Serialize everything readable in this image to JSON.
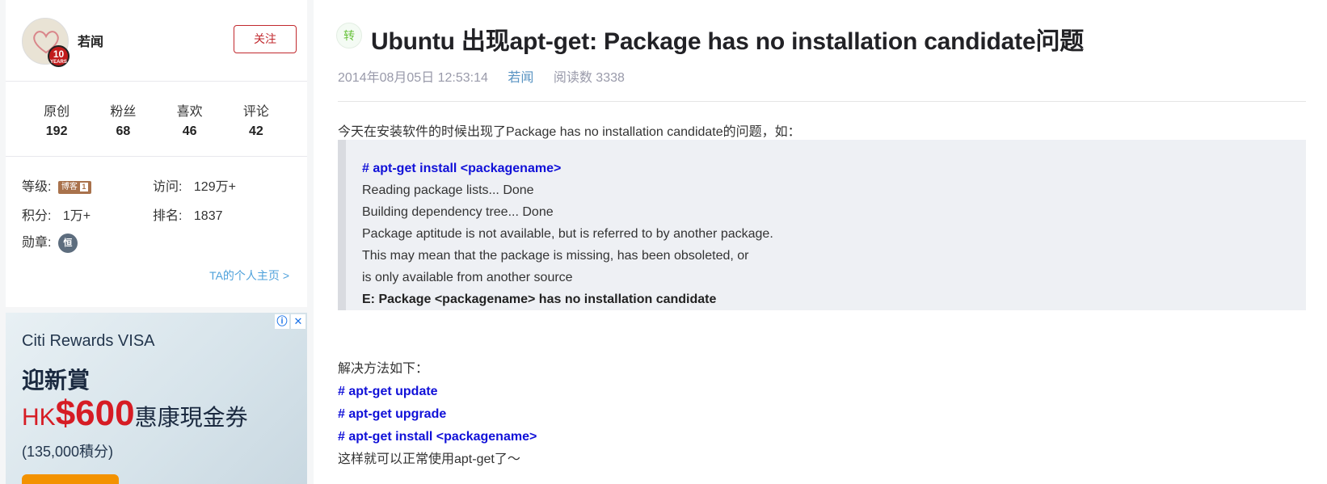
{
  "profile": {
    "username": "若闻",
    "years_badge": "10",
    "years_text": "YEARS",
    "follow_label": "关注",
    "stats": [
      {
        "label": "原创",
        "value": "192"
      },
      {
        "label": "粉丝",
        "value": "68"
      },
      {
        "label": "喜欢",
        "value": "46"
      },
      {
        "label": "评论",
        "value": "42"
      }
    ],
    "level_label": "等级:",
    "level_badge": "博客",
    "level_num": "1",
    "visits_label": "访问:",
    "visits_value": "129万+",
    "points_label": "积分:",
    "points_value": "1万+",
    "rank_label": "排名:",
    "rank_value": "1837",
    "medal_label": "勋章:",
    "medal_char": "恒",
    "home_link": "TA的个人主页 >"
  },
  "ad": {
    "info_icon": "ⓘ",
    "close_icon": "✕",
    "line1": "Citi Rewards VISA",
    "line2": "迎新賞",
    "hk": "HK",
    "amount": "$600",
    "line3_rest": "惠康現金券",
    "line4": "(135,000積分)",
    "accent_color": "#d61c24"
  },
  "article": {
    "repost_tag": "转",
    "title": "Ubuntu 出现apt-get: Package has no installation candidate问题",
    "date": "2014年08月05日 12:53:14",
    "author": "若闻",
    "reads": "阅读数 3338",
    "intro": "今天在安装软件的时候出现了Package has no installation candidate的问题，如：",
    "code_lines": [
      "#  apt-get install <packagename>",
      "Reading package lists... Done",
      "Building dependency tree... Done",
      "Package aptitude is not available, but is referred to by another package.",
      "This may mean that the package is missing, has been obsoleted, or",
      "is only available from another source",
      "E: Package <packagename> has no installation candidate"
    ],
    "solution_heading": "解决方法如下：",
    "solution_cmds": [
      "# apt-get update",
      "# apt-get upgrade",
      "# apt-get install <packagename>"
    ],
    "closing": "这样就可以正常使用apt-get了～"
  }
}
